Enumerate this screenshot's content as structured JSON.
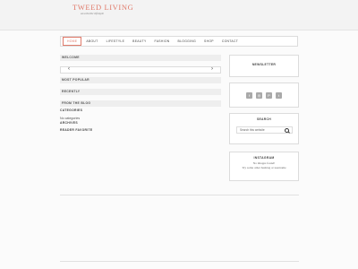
{
  "brand": {
    "title": "TWEED LIVING",
    "tagline": "an eclectic lifestyle"
  },
  "nav": {
    "items": [
      {
        "label": "HOME",
        "active": true
      },
      {
        "label": "ABOUT"
      },
      {
        "label": "LIFESTYLE"
      },
      {
        "label": "BEAUTY"
      },
      {
        "label": "FASHION"
      },
      {
        "label": "BLOGGING"
      },
      {
        "label": "SHOP"
      },
      {
        "label": "CONTACT"
      }
    ]
  },
  "main": {
    "welcome": "WELCOME",
    "slider": {
      "prev": "‹",
      "next": "›"
    },
    "most_popular": "MOST POPULAR",
    "recently": "RECENTLY",
    "from_blog": "FROM THE BLOG",
    "categories": "CATEGORIES",
    "no_categories": "No categories",
    "archives": "ARCHIVES",
    "reader_favorite": "READER FAVORITE"
  },
  "sidebar": {
    "newsletter": "NEWSLETTER",
    "social": [
      "f",
      "◎",
      "P",
      "t"
    ],
    "search_title": "SEARCH",
    "search_placeholder": "Search this website",
    "instagram_title": "INSTAGRAM",
    "instagram_line1": "No images found!",
    "instagram_line2": "Try some other hashtag or username"
  }
}
